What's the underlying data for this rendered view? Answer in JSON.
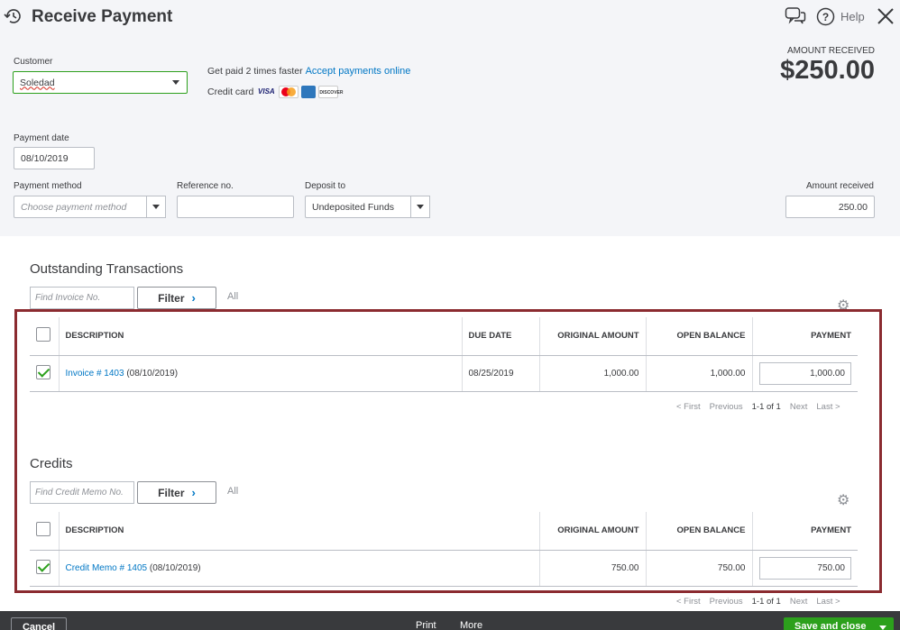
{
  "header": {
    "title": "Receive Payment",
    "help_label": "Help"
  },
  "customer": {
    "label": "Customer",
    "value": "Soledad"
  },
  "promo": {
    "text": "Get paid 2 times faster",
    "link": "Accept payments online",
    "credit_card_label": "Credit card",
    "cards": [
      "VISA",
      "mastercard",
      "amex",
      "DISCOVER"
    ]
  },
  "amount_summary": {
    "label": "AMOUNT RECEIVED",
    "value": "$250.00"
  },
  "payment_date": {
    "label": "Payment date",
    "value": "08/10/2019"
  },
  "payment_method": {
    "label": "Payment method",
    "placeholder": "Choose payment method"
  },
  "reference": {
    "label": "Reference no.",
    "value": ""
  },
  "deposit_to": {
    "label": "Deposit to",
    "value": "Undeposited Funds"
  },
  "amount_received": {
    "label": "Amount received",
    "value": "250.00"
  },
  "outstanding": {
    "title": "Outstanding Transactions",
    "find_placeholder": "Find Invoice No.",
    "filter_label": "Filter",
    "all_label": "All",
    "columns": [
      "DESCRIPTION",
      "DUE DATE",
      "ORIGINAL AMOUNT",
      "OPEN BALANCE",
      "PAYMENT"
    ],
    "rows": [
      {
        "checked": true,
        "link": "Invoice # 1403",
        "date_suffix": "(08/10/2019)",
        "due_date": "08/25/2019",
        "original": "1,000.00",
        "open": "1,000.00",
        "payment": "1,000.00"
      }
    ],
    "pager": {
      "first": "< First",
      "previous": "Previous",
      "count": "1-1 of 1",
      "next": "Next",
      "last": "Last >"
    }
  },
  "credits": {
    "title": "Credits",
    "find_placeholder": "Find Credit Memo No.",
    "filter_label": "Filter",
    "all_label": "All",
    "columns": [
      "DESCRIPTION",
      "ORIGINAL AMOUNT",
      "OPEN BALANCE",
      "PAYMENT"
    ],
    "rows": [
      {
        "checked": true,
        "link": "Credit Memo # 1405",
        "date_suffix": "(08/10/2019)",
        "original": "750.00",
        "open": "750.00",
        "payment": "750.00"
      }
    ],
    "pager": {
      "first": "< First",
      "previous": "Previous",
      "count": "1-1 of 1",
      "next": "Next",
      "last": "Last >"
    }
  },
  "footer": {
    "cancel": "Cancel",
    "print": "Print",
    "more": "More",
    "save": "Save and close"
  },
  "colors": {
    "accent_green": "#2ca01c",
    "link_blue": "#0077c5",
    "highlight_border": "#8b2b30"
  }
}
